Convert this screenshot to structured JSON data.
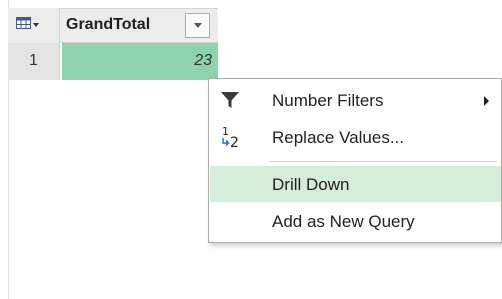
{
  "table": {
    "column_header": "GrandTotal",
    "rows": [
      {
        "number": "1",
        "value": "23"
      }
    ],
    "icons": {
      "table_menu": "table-icon",
      "column_filter": "dropdown-arrow-icon"
    }
  },
  "context_menu": {
    "items": [
      {
        "label": "Number Filters",
        "icon": "filter-funnel-icon",
        "has_submenu": true,
        "highlighted": false
      },
      {
        "label": "Replace Values...",
        "icon": "replace-values-icon",
        "has_submenu": false,
        "highlighted": false
      },
      {
        "label": "Drill Down",
        "icon": "",
        "has_submenu": false,
        "highlighted": true
      },
      {
        "label": "Add as New Query",
        "icon": "",
        "has_submenu": false,
        "highlighted": false
      }
    ],
    "highlight_color": "#d4edda"
  },
  "colors": {
    "selected_cell": "#8fd3ad",
    "header_bg": "#ececec"
  }
}
